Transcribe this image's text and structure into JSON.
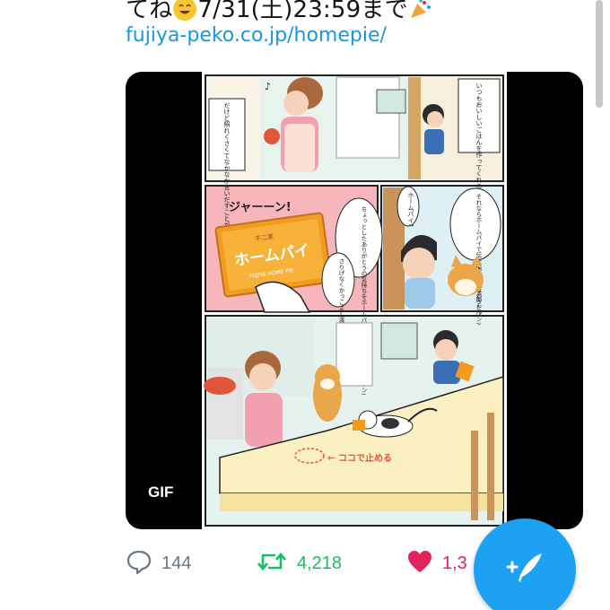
{
  "tweet": {
    "text_start": "てね",
    "text_date": "7/31(土)23:59まで",
    "link": "fujiya-peko.co.jp/homepie/"
  },
  "media": {
    "badge": "GIF",
    "comic": {
      "caption_taro": "いつもおいしいごはんを作ってくれるお母さんに感謝の気持ちを伝えたい太郎くん",
      "caption_mother": "だけど照れくさくてなかなか言いだすことができません",
      "sfx_jaan": "ジャーーン!",
      "package_maker": "不二家",
      "package_name": "ホームパイ",
      "package_en": "FUJIYA HOME PIE",
      "dog_suggest": "それならホームパイで伝えてみるのはどうだワン?",
      "boy_question": "ホームパイ?",
      "dog_explain": "ちょっとしたありがとうの気持ちをホームパイにのせて渡すことだワン!",
      "dog_cool": "さりげなくかっこよく渡すワン!",
      "stop_here": "ココで止める"
    }
  },
  "actions": {
    "reply_count": "144",
    "retweet_count": "4,218",
    "like_count": "1,3"
  },
  "colors": {
    "link": "#1b95e0",
    "retweet": "#17bf63",
    "like": "#e0245e",
    "fab": "#1da1f2"
  },
  "icons": {
    "reply": "reply-icon",
    "retweet": "retweet-icon",
    "like": "heart-icon",
    "compose": "compose-tweet-icon"
  }
}
